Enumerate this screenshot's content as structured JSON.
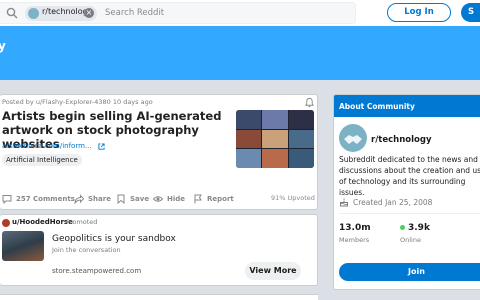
{
  "header": {
    "subreddit_chip": "r/technology",
    "search_placeholder": "Search Reddit",
    "login_label": "Log In",
    "signup_label": "S"
  },
  "banner": {
    "title": "y"
  },
  "post": {
    "meta": "Posted by u/Flashy-Explorer-4380 10 days ago",
    "title": "Artists begin selling AI-generated artwork on stock photography websites",
    "link": "arstechnica.com/inform...",
    "flair": "Artificial Intelligence",
    "actions": {
      "comments": "257 Comments",
      "share": "Share",
      "save": "Save",
      "hide": "Hide",
      "report": "Report"
    },
    "upvoted": "91% Upvoted",
    "thumbnail_colors": [
      "#3b4a6b",
      "#6b7aa8",
      "#2c2f45",
      "#8a4a3a",
      "#c9a27a",
      "#4a6a8a",
      "#6a8ab0",
      "#b86a4a",
      "#3a5a7a"
    ]
  },
  "promo": {
    "user": "u/HoodedHorse",
    "tag": "· Promoted",
    "title": "Geopolitics is your sandbox",
    "subtitle": "Join the conversation",
    "domain": "store.steampowered.com",
    "cta": "View More"
  },
  "about": {
    "heading": "About Community",
    "name": "r/technology",
    "description": "Subreddit dedicated to the news and discussions about the creation and use of technology and its surrounding issues.",
    "created": "Created Jan 25, 2008",
    "members_value": "13.0m",
    "members_label": "Members",
    "online_value": "3.9k",
    "online_label": "Online",
    "join_label": "Join"
  },
  "colors": {
    "brand_blue": "#0079d3",
    "banner_blue": "#33a8ff",
    "online_green": "#46d160"
  }
}
